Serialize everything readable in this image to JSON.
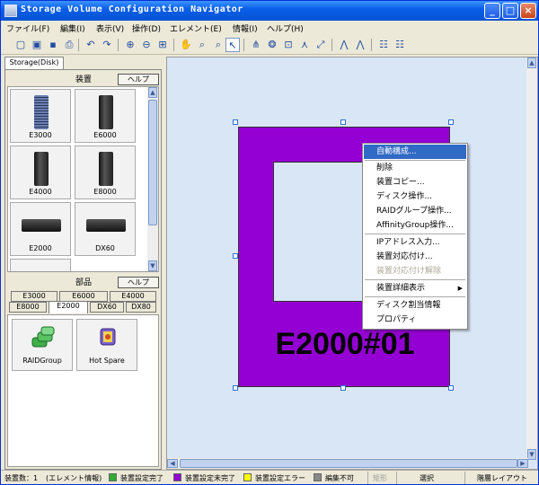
{
  "window": {
    "title": "Storage Volume Configuration Navigator"
  },
  "menu": [
    "ファイル(F)",
    "編集(I)",
    "表示(V)",
    "操作(D)",
    "エレメント(E)",
    "情報(I)",
    "ヘルプ(H)"
  ],
  "left": {
    "tab": "Storage(Disk)",
    "devices_header": "装置",
    "parts_header": "部品",
    "help_label": "ヘルプ",
    "devices": [
      "E3000",
      "E6000",
      "E4000",
      "E8000",
      "E2000",
      "DX60"
    ],
    "part_tabs_row1": [
      "E3000",
      "E6000",
      "E4000"
    ],
    "part_tabs_row2": [
      "E8000",
      "E2000",
      "DX60",
      "DX80"
    ],
    "parts": [
      "RAIDGroup",
      "Hot Spare"
    ]
  },
  "canvas": {
    "device_label": "E2000#01",
    "device_color": "#9400d3"
  },
  "context_menu": [
    {
      "label": "自動構成...",
      "state": "highlight"
    },
    {
      "label": "削除",
      "state": "normal"
    },
    {
      "label": "装置コピー...",
      "state": "normal"
    },
    {
      "label": "ディスク操作...",
      "state": "normal"
    },
    {
      "label": "RAIDグループ操作...",
      "state": "normal"
    },
    {
      "label": "AffinityGroup操作...",
      "state": "normal"
    },
    {
      "label": "IPアドレス入力...",
      "state": "normal"
    },
    {
      "label": "装置対応付け...",
      "state": "normal"
    },
    {
      "label": "装置対応付け解除",
      "state": "disabled"
    },
    {
      "label": "装置詳細表示",
      "state": "submenu"
    },
    {
      "label": "ディスク割当情報",
      "state": "normal"
    },
    {
      "label": "プロパティ",
      "state": "normal"
    }
  ],
  "status": {
    "count": "装置数：1",
    "info": "(エレメント情報)",
    "legend": [
      {
        "label": "装置設定完了",
        "color": "#33aa33"
      },
      {
        "label": "装置設定未完了",
        "color": "#9400d3"
      },
      {
        "label": "装置設定エラー",
        "color": "#ffff00"
      },
      {
        "label": "編集不可",
        "color": "#888888"
      }
    ],
    "shape": "矩形",
    "mode": "選択",
    "layout": "階層レイアウト"
  }
}
